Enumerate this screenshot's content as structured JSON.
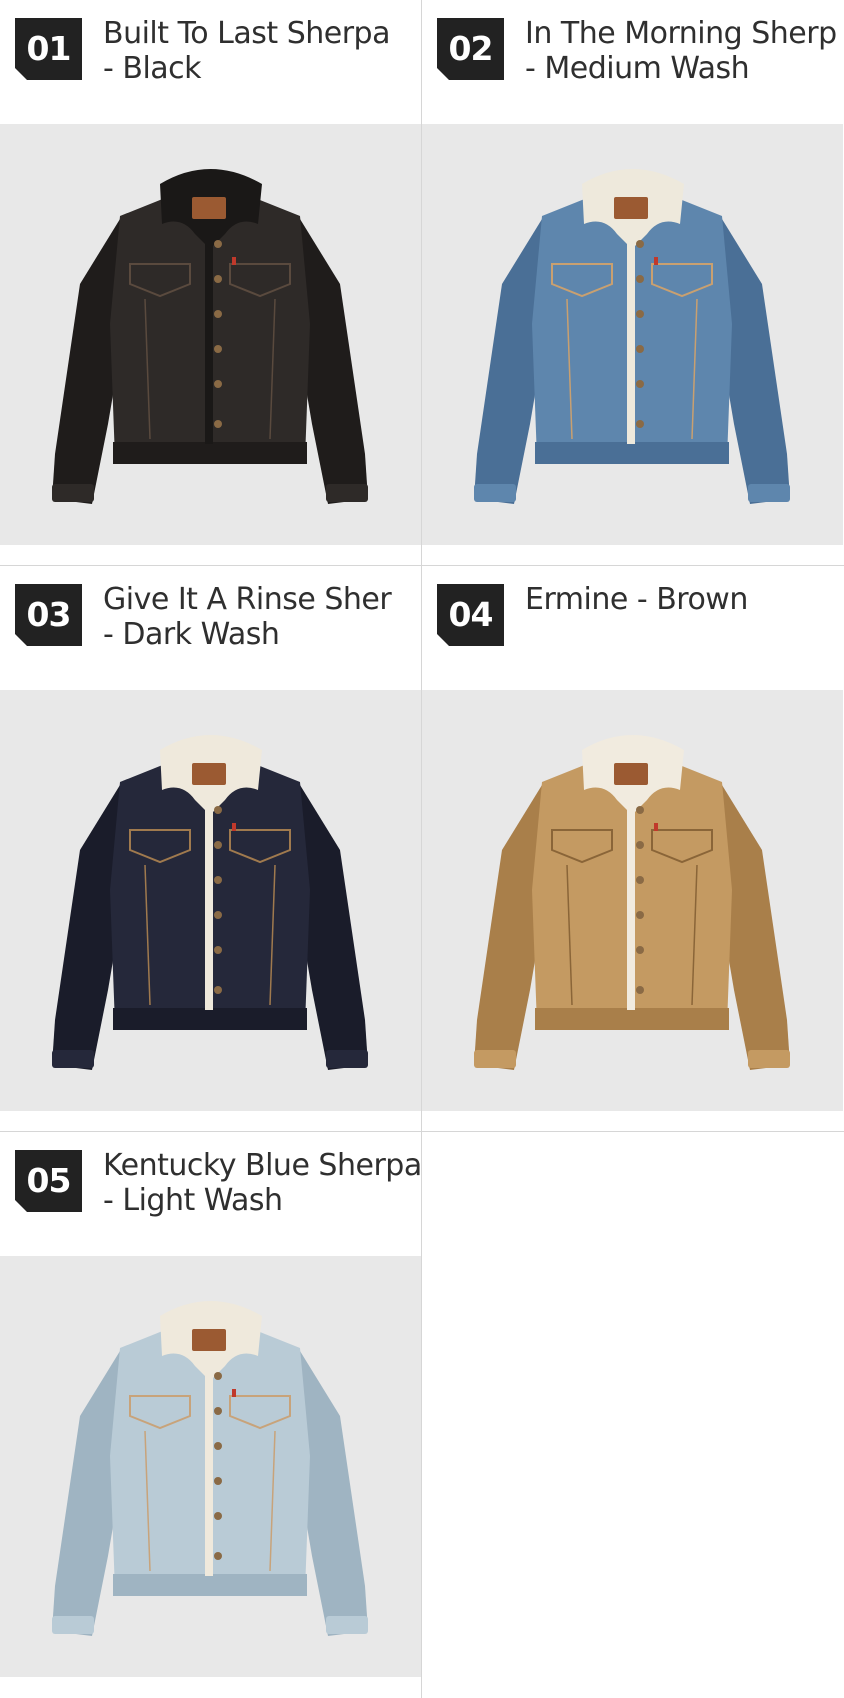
{
  "products": [
    {
      "number": "01",
      "title_line1": "Built To Last Sherpa",
      "title_line2": " - Black",
      "colors": {
        "body": "#2e2a28",
        "shade": "#1f1c1b",
        "collar": "#1a1817",
        "stitch": "#5a4a3e",
        "lining": "#1a1817"
      }
    },
    {
      "number": "02",
      "title_line1": "In The Morning Sherp",
      "title_line2": " - Medium Wash",
      "colors": {
        "body": "#5e86ad",
        "shade": "#4a6f96",
        "collar": "#eee9dc",
        "stitch": "#c9a070",
        "lining": "#eee9dc"
      }
    },
    {
      "number": "03",
      "title_line1": "Give It A Rinse Sher",
      "title_line2": " - Dark Wash",
      "colors": {
        "body": "#25283a",
        "shade": "#1a1c2a",
        "collar": "#efe9dc",
        "stitch": "#a07a4e",
        "lining": "#efe9dc"
      }
    },
    {
      "number": "04",
      "title_line1": "Ermine - Brown",
      "title_line2": "",
      "colors": {
        "body": "#c49a62",
        "shade": "#a97f4a",
        "collar": "#f1ebdf",
        "stitch": "#8a6538",
        "lining": "#f1ebdf"
      }
    },
    {
      "number": "05",
      "title_line1": "Kentucky Blue Sherpa",
      "title_line2": " - Light Wash",
      "colors": {
        "body": "#b9cbd6",
        "shade": "#9fb4c2",
        "collar": "#efe9dc",
        "stitch": "#c8a37a",
        "lining": "#efe9dc"
      }
    }
  ],
  "theme": {
    "badge_color": "#222222",
    "photo_bg": "#e8e8e8",
    "patch": "#9b5a32"
  }
}
